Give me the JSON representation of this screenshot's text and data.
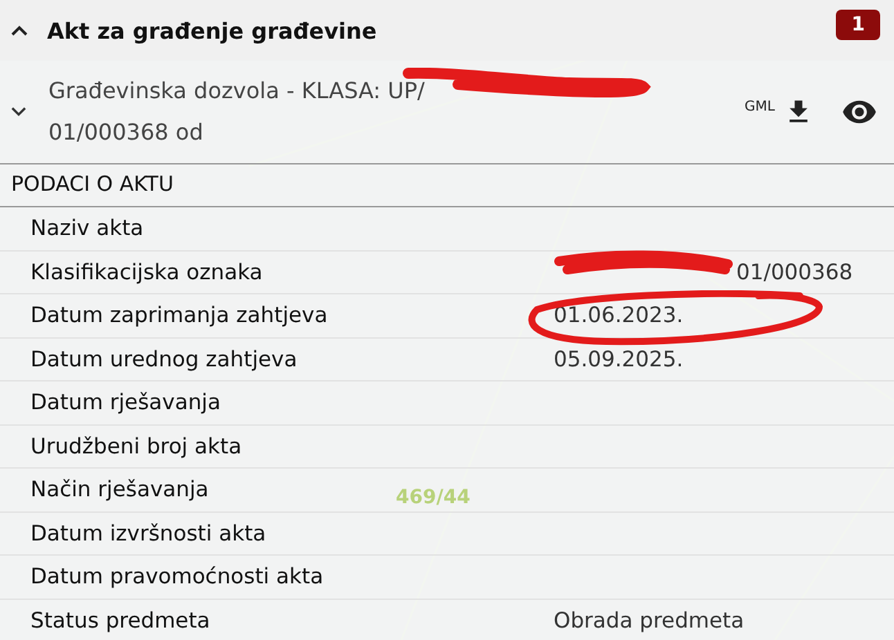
{
  "section": {
    "title": "Akt za građenje građevine",
    "expanded": true,
    "count": "1"
  },
  "act": {
    "title_line_1": "Građevinska dozvola - KLASA: UP/",
    "title_line_2": "01/000368 od",
    "expanded": false,
    "format_label": "GML"
  },
  "details": {
    "heading": "PODACI O AKTU",
    "rows": [
      {
        "label": "Naziv akta",
        "value": ""
      },
      {
        "label": "Klasifikacijska oznaka",
        "value": "01/000368",
        "redacted": true
      },
      {
        "label": "Datum zaprimanja zahtjeva",
        "value": "01.06.2023.",
        "circled": true
      },
      {
        "label": "Datum urednog zahtjeva",
        "value": "05.09.2025."
      },
      {
        "label": "Datum rješavanja",
        "value": ""
      },
      {
        "label": "Urudžbeni broj akta",
        "value": ""
      },
      {
        "label": "Način rješavanja",
        "value": ""
      },
      {
        "label": "Datum izvršnosti akta",
        "value": ""
      },
      {
        "label": "Datum pravomoćnosti akta",
        "value": ""
      },
      {
        "label": "Status predmeta",
        "value": "Obrada predmeta"
      }
    ]
  },
  "map": {
    "parcel_label": "469/44"
  }
}
